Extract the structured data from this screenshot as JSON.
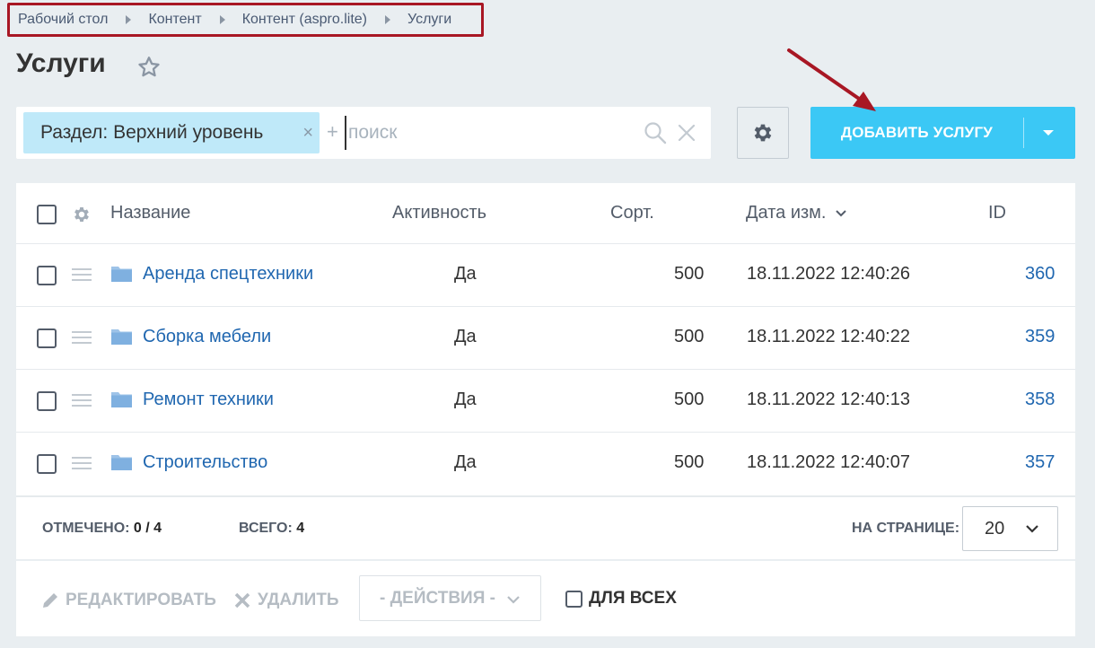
{
  "breadcrumb": [
    "Рабочий стол",
    "Контент",
    "Контент (aspro.lite)",
    "Услуги"
  ],
  "page": {
    "title": "Услуги"
  },
  "filter": {
    "tag_label": "Раздел: Верхний уровень",
    "tag_close": "×",
    "plus": "+",
    "search_placeholder": "поиск"
  },
  "toolbar": {
    "add_label": "ДОБАВИТЬ УСЛУГУ"
  },
  "table": {
    "headers": {
      "name": "Название",
      "active": "Активность",
      "sort": "Сорт.",
      "date": "Дата изм.",
      "id": "ID"
    },
    "rows": [
      {
        "name": "Аренда спецтехники",
        "active": "Да",
        "sort": "500",
        "date": "18.11.2022 12:40:26",
        "id": "360"
      },
      {
        "name": "Сборка мебели",
        "active": "Да",
        "sort": "500",
        "date": "18.11.2022 12:40:22",
        "id": "359"
      },
      {
        "name": "Ремонт техники",
        "active": "Да",
        "sort": "500",
        "date": "18.11.2022 12:40:13",
        "id": "358"
      },
      {
        "name": "Строительство",
        "active": "Да",
        "sort": "500",
        "date": "18.11.2022 12:40:07",
        "id": "357"
      }
    ]
  },
  "footer": {
    "selected_label": "ОТМЕЧЕНО:",
    "selected_value": "0 / 4",
    "total_label": "ВСЕГО:",
    "total_value": "4",
    "per_page_label": "НА СТРАНИЦЕ:",
    "per_page_value": "20"
  },
  "actions": {
    "edit_label": "РЕДАКТИРОВАТЬ",
    "delete_label": "УДАЛИТЬ",
    "actions_select": "- ДЕЙСТВИЯ -",
    "for_all_label": "ДЛЯ ВСЕХ"
  },
  "colors": {
    "accent": "#3bc8f5",
    "link": "#2067b0",
    "tag_bg": "#bfe9f9",
    "annotation": "#a81724",
    "page_bg": "#e9eef1"
  },
  "icons": {
    "favorite": "star-icon",
    "search": "search-icon",
    "clear": "close-icon",
    "settings": "gear-icon",
    "row_drag": "drag-handle-icon",
    "row_type": "folder-icon",
    "edit": "pencil-icon",
    "delete": "cross-icon"
  }
}
